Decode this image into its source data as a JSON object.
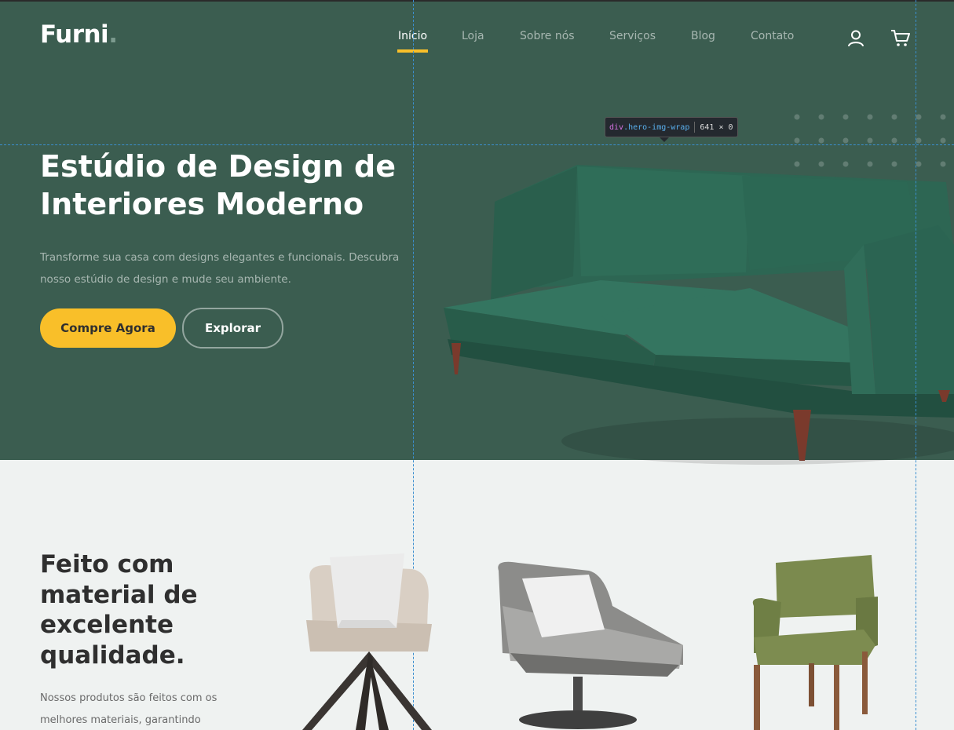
{
  "brand": {
    "name": "Furni",
    "dot": "."
  },
  "nav": {
    "items": [
      {
        "label": "Início",
        "active": true
      },
      {
        "label": "Loja",
        "active": false
      },
      {
        "label": "Sobre nós",
        "active": false
      },
      {
        "label": "Serviços",
        "active": false
      },
      {
        "label": "Blog",
        "active": false
      },
      {
        "label": "Contato",
        "active": false
      }
    ],
    "icons": [
      "user-icon",
      "cart-icon"
    ]
  },
  "hero": {
    "title": "Estúdio de Design de Interiores Moderno",
    "text": "Transforme sua casa com designs elegantes e funcionais. Descubra nosso estúdio de design e mude seu ambiente.",
    "primary_button": "Compre Agora",
    "secondary_button": "Explorar"
  },
  "inspector": {
    "tag": "div",
    "class": ".hero-img-wrap",
    "size": "641 × 0"
  },
  "section": {
    "title": "Feito com material de excelente qualidade.",
    "text": "Nossos produtos são feitos com os melhores materiais, garantindo"
  },
  "colors": {
    "hero_bg": "#3b5d50",
    "accent": "#f9bf29",
    "section_bg": "#eff2f1",
    "sofa": "#2e6a55"
  }
}
